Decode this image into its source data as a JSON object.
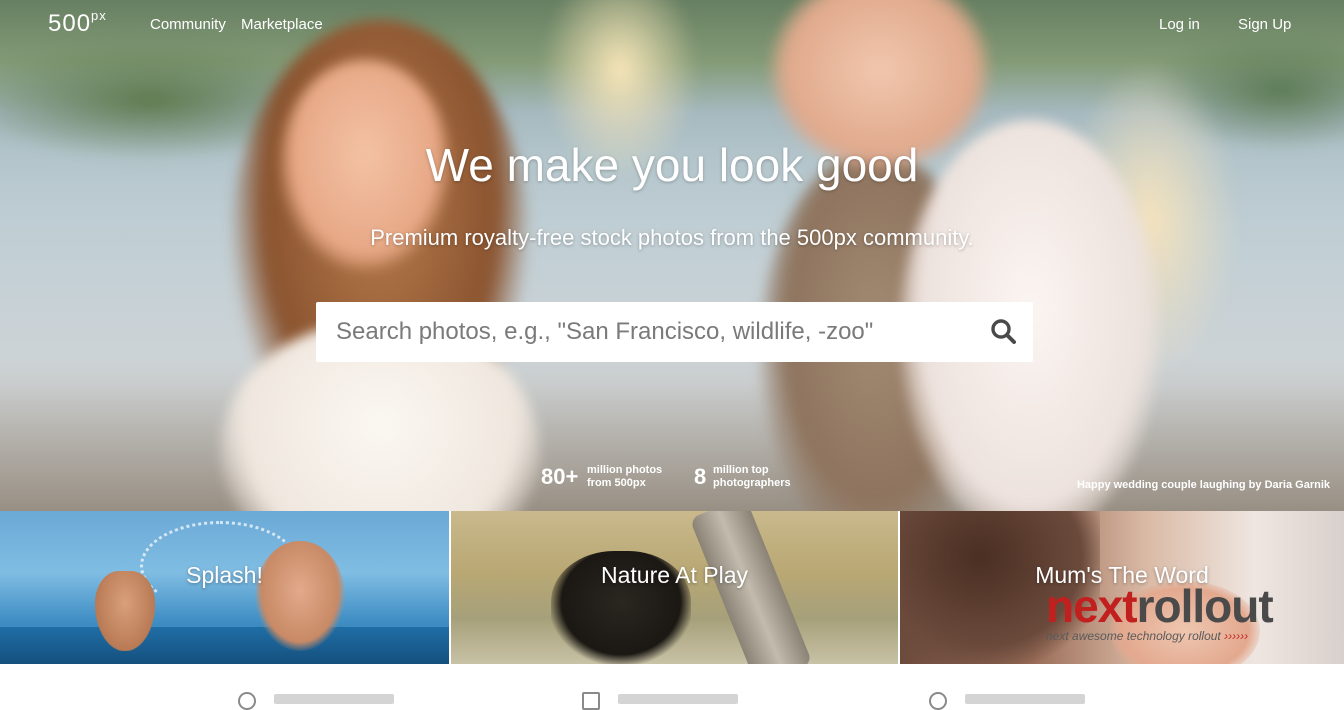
{
  "nav": {
    "logo": "500",
    "logo_sup": "px",
    "links": [
      "Community",
      "Marketplace"
    ],
    "login": "Log in",
    "signup": "Sign Up"
  },
  "hero": {
    "headline": "We make you look good",
    "subline": "Premium royalty-free stock photos from the 500px community.",
    "search_placeholder": "Search photos, e.g., \"San Francisco, wildlife, -zoo\"",
    "stats": [
      {
        "value": "80+",
        "label_line1": "million photos",
        "label_line2": "from 500px"
      },
      {
        "value": "8",
        "label_line1": "million top",
        "label_line2": "photographers"
      }
    ],
    "credit": "Happy wedding couple laughing by Daria Garnik"
  },
  "tiles": [
    {
      "title": "Splash!"
    },
    {
      "title": "Nature At Play"
    },
    {
      "title": "Mum's The Word"
    }
  ],
  "watermark": {
    "brand_a": "next",
    "brand_b": "rollout",
    "tagline": "next awesome technology rollout",
    "arrows": "››››››"
  },
  "icons": {
    "search": "search-icon"
  },
  "colors": {
    "watermark_red": "#c21f1f",
    "text_white": "#ffffff"
  }
}
